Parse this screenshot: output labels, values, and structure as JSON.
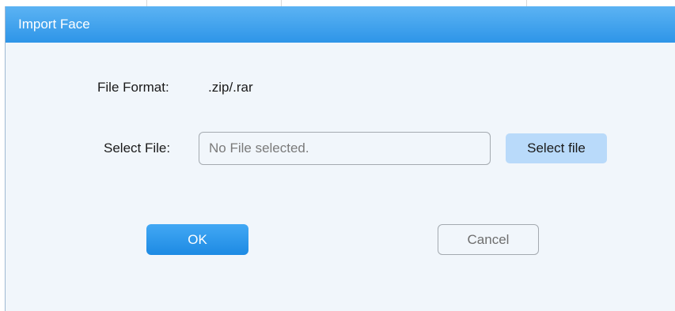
{
  "dialog": {
    "title": "Import Face"
  },
  "file_format": {
    "label": "File Format:",
    "value": ".zip/.rar"
  },
  "select_file": {
    "label": "Select File:",
    "placeholder": "No File selected.",
    "button_label": "Select file"
  },
  "actions": {
    "ok_label": "OK",
    "cancel_label": "Cancel"
  },
  "colors": {
    "title_bar": "#3a9eec",
    "ok_button": "#2f97ea",
    "select_button": "#b9dafa",
    "dialog_background": "#f1f6fb"
  }
}
